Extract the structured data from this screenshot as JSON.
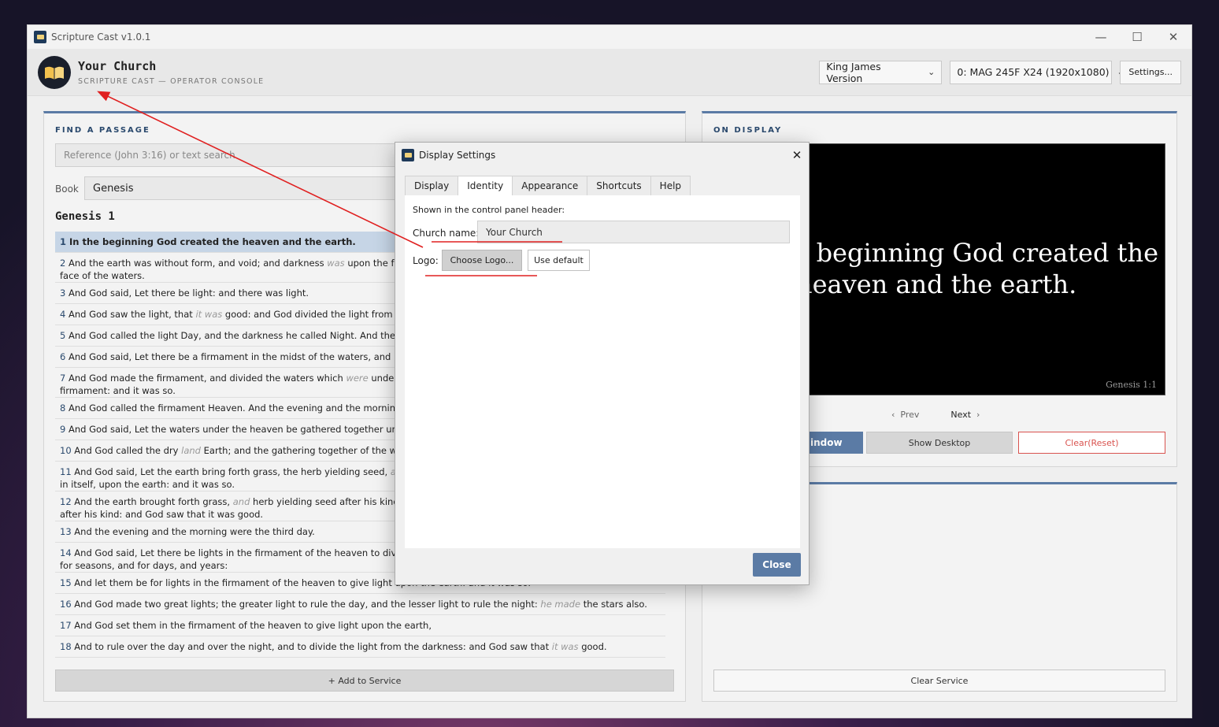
{
  "window": {
    "title": "Scripture Cast v1.0.1",
    "min": "—",
    "max": "☐",
    "close": "✕"
  },
  "header": {
    "church_name": "Your Church",
    "subtitle": "SCRIPTURE CAST — OPERATOR CONSOLE",
    "version_select": "King James Version",
    "display_select": "0: MAG 245F X24 (1920x1080)",
    "settings_label": "Settings..."
  },
  "find": {
    "title": "FIND A PASSAGE",
    "search_placeholder": "Reference (John 3:16) or text search",
    "book_label": "Book",
    "book_value": "Genesis",
    "chapter_heading": "Genesis 1",
    "add_button": "+ Add to Service",
    "verses": [
      {
        "num": "1",
        "text": "In the beginning God created the heaven and the earth."
      },
      {
        "num": "2",
        "pre": "And the earth was without form, and void; and darkness ",
        "it": "was",
        "post": " upon the face of the deep. And the Spirit of God moved upon the face of the waters."
      },
      {
        "num": "3",
        "text": "And God said, Let there be light: and there was light."
      },
      {
        "num": "4",
        "pre": "And God saw the light, that ",
        "it": "it was",
        "post": " good: and God divided the light from the darkness."
      },
      {
        "num": "5",
        "text": "And God called the light Day, and the darkness he called Night. And the evening and the morning were the first day."
      },
      {
        "num": "6",
        "text": "And God said, Let there be a firmament in the midst of the waters, and let it divide the waters from the waters."
      },
      {
        "num": "7",
        "pre": "And God made the firmament, and divided the waters which ",
        "it": "were",
        "post": " under the firmament from the waters which were above the firmament: and it was so."
      },
      {
        "num": "8",
        "text": "And God called the firmament Heaven. And the evening and the morning were the second day."
      },
      {
        "num": "9",
        "text": "And God said, Let the waters under the heaven be gathered together unto one place, and let the dry land appear: and it was so."
      },
      {
        "num": "10",
        "pre": "And God called the dry ",
        "it": "land",
        "post": " Earth; and the gathering together of the waters called he Seas: and God saw that it was good."
      },
      {
        "num": "11",
        "pre": "And God said, Let the earth bring forth grass, the herb yielding seed, ",
        "it": "and",
        "post": " the fruit tree yielding fruit after his kind, whose seed is in itself, upon the earth: and it was so."
      },
      {
        "num": "12",
        "pre": "And the earth brought forth grass, ",
        "it": "and",
        "post": " herb yielding seed after his kind, and the tree yielding fruit, whose seed was in itself, after his kind: and God saw that it was good."
      },
      {
        "num": "13",
        "text": "And the evening and the morning were the third day."
      },
      {
        "num": "14",
        "text": "And God said, Let there be lights in the firmament of the heaven to divide the day from the night; and let them be for signs, and for seasons, and for days, and years:"
      },
      {
        "num": "15",
        "text": "And let them be for lights in the firmament of the heaven to give light upon the earth: and it was so."
      },
      {
        "num": "16",
        "pre": "And God made two great lights; the greater light to rule the day, and the lesser light to rule the night: ",
        "it": "he made",
        "post": " the stars also."
      },
      {
        "num": "17",
        "text": "And God set them in the firmament of the heaven to give light upon the earth,"
      },
      {
        "num": "18",
        "pre": "And to rule over the day and over the night, and to divide the light from the darkness: and God saw that ",
        "it": "it was",
        "post": " good."
      }
    ]
  },
  "display": {
    "title": "ON DISPLAY",
    "preview_line1": "e beginning God created the",
    "preview_line2": "heaven and the earth.",
    "preview_ref": "Genesis 1:1",
    "prev": "Prev",
    "next": "Next",
    "window_btn": "indow",
    "show_desktop": "Show Desktop",
    "clear_reset": "Clear(Reset)",
    "clear_service": "Clear Service"
  },
  "dialog": {
    "title": "Display Settings",
    "tabs": [
      "Display",
      "Identity",
      "Appearance",
      "Shortcuts",
      "Help"
    ],
    "hint": "Shown in the control panel header:",
    "church_label": "Church name:",
    "church_value": "Your Church",
    "logo_label": "Logo:",
    "choose_logo": "Choose Logo...",
    "use_default": "Use default",
    "close": "Close"
  },
  "colors": {
    "accent": "#5b7ba5",
    "annotation": "#e02020",
    "danger": "#d9534f"
  }
}
